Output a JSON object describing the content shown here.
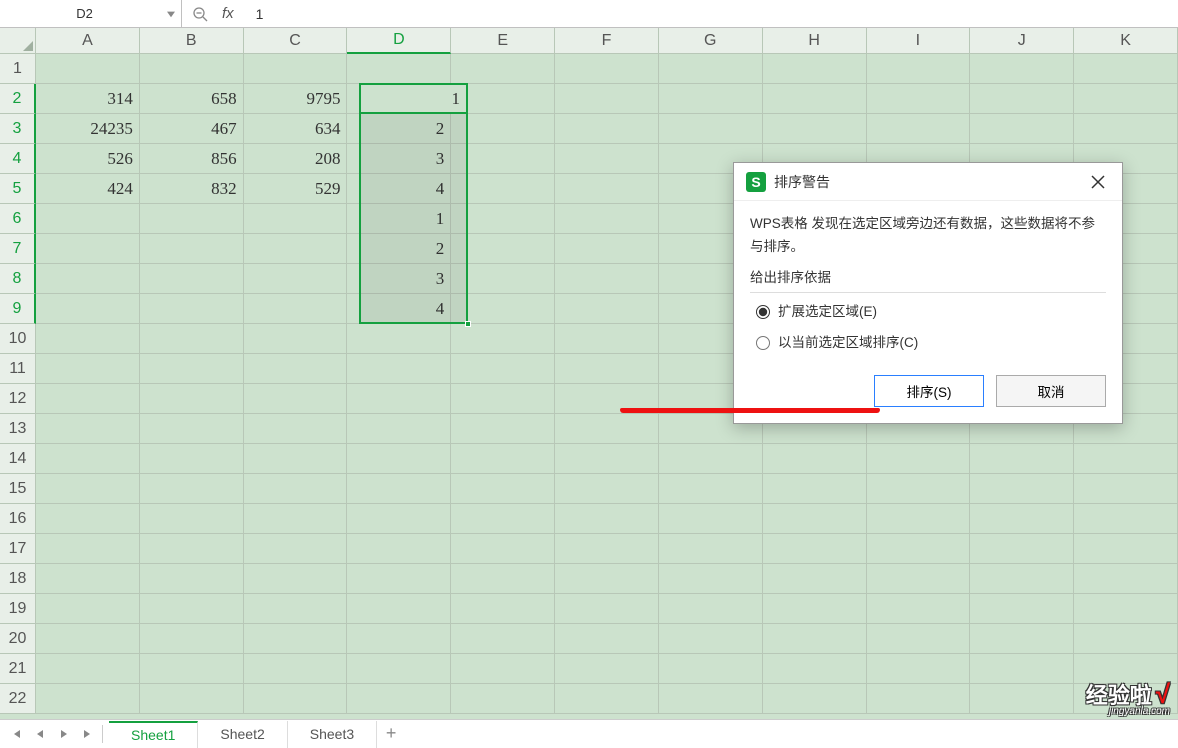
{
  "formula_bar": {
    "cell_ref": "D2",
    "fx_label": "fx",
    "value": "1"
  },
  "columns": [
    "A",
    "B",
    "C",
    "D",
    "E",
    "F",
    "G",
    "H",
    "I",
    "J",
    "K"
  ],
  "active_col_index": 3,
  "rows": [
    "1",
    "2",
    "3",
    "4",
    "5",
    "6",
    "7",
    "8",
    "9",
    "10",
    "11",
    "12",
    "13",
    "14",
    "15",
    "16",
    "17",
    "18",
    "19",
    "20",
    "21",
    "22"
  ],
  "active_rows": [
    1,
    2,
    3,
    4,
    5,
    6,
    7,
    8
  ],
  "data": {
    "A": {
      "2": "314",
      "3": "24235",
      "4": "526",
      "5": "424"
    },
    "B": {
      "2": "658",
      "3": "467",
      "4": "856",
      "5": "832"
    },
    "C": {
      "2": "9795",
      "3": "634",
      "4": "208",
      "5": "529"
    },
    "D": {
      "2": "1",
      "3": "2",
      "4": "3",
      "5": "4",
      "6": "1",
      "7": "2",
      "8": "3",
      "9": "4"
    }
  },
  "selection": {
    "col": "D",
    "row_start": 2,
    "row_end": 9
  },
  "dialog": {
    "title": "排序警告",
    "logo_letter": "S",
    "desc": "WPS表格 发现在选定区域旁边还有数据，这些数据将不参与排序。",
    "section_label": "给出排序依据",
    "option_expand": "扩展选定区域(E)",
    "option_current": "以当前选定区域排序(C)",
    "btn_sort": "排序(S)",
    "btn_cancel": "取消"
  },
  "sheets": {
    "tabs": [
      "Sheet1",
      "Sheet2",
      "Sheet3"
    ],
    "active": 0,
    "add_label": "+"
  },
  "watermark": {
    "main": "经验啦",
    "check": "√",
    "sub": "jingyanla.com"
  }
}
